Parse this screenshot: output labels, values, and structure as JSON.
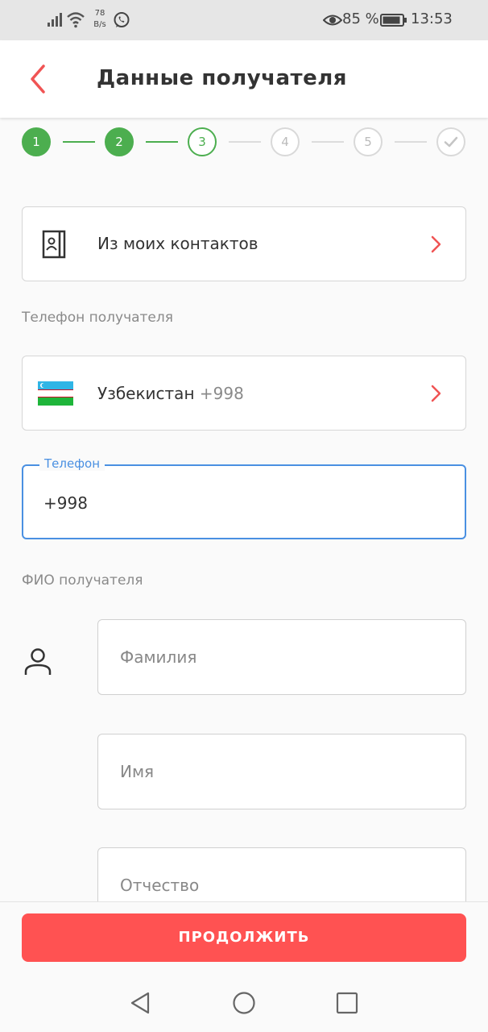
{
  "status_bar": {
    "speed_value": "78",
    "speed_unit": "B/s",
    "battery": "85 %",
    "time": "13:53",
    "icons": [
      "signal-icon",
      "wifi-icon",
      "whatsapp-icon",
      "eye-icon",
      "battery-icon"
    ]
  },
  "header": {
    "title": "Данные получателя",
    "back_icon": "chevron-left-icon"
  },
  "stepper": {
    "steps": [
      {
        "label": "1",
        "state": "done"
      },
      {
        "label": "2",
        "state": "done"
      },
      {
        "label": "3",
        "state": "current"
      },
      {
        "label": "4",
        "state": "pending"
      },
      {
        "label": "5",
        "state": "pending"
      },
      {
        "label": "",
        "state": "pending",
        "icon": "check-icon"
      }
    ]
  },
  "contacts": {
    "label": "Из моих контактов",
    "icon": "contact-book-icon"
  },
  "phone_section": {
    "label": "Телефон получателя",
    "country": "Узбекистан",
    "dial_code": "+998",
    "flag_icon": "uzbekistan-flag-icon",
    "field_legend": "Телефон",
    "field_value": "+998"
  },
  "name_section": {
    "label": "ФИО получателя",
    "icon": "person-icon",
    "last_name_placeholder": "Фамилия",
    "first_name_placeholder": "Имя",
    "middle_name_placeholder": "Отчество"
  },
  "footer": {
    "continue_label": "ПРОДОЛЖИТЬ"
  },
  "colors": {
    "accent_red": "#ff5252",
    "step_green": "#4cae4f",
    "focus_blue": "#4a90e2"
  }
}
